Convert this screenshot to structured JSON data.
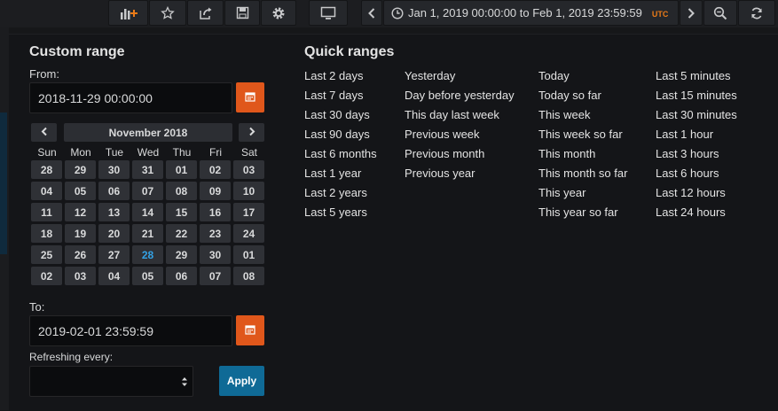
{
  "toolbar": {
    "time_range": "Jan 1, 2019 00:00:00 to Feb 1, 2019 23:59:59",
    "timezone": "UTC",
    "buttons": [
      "add-panel-icon",
      "star-icon",
      "share-icon",
      "save-icon",
      "settings-icon",
      "tv-mode-icon",
      "chevron-left-icon",
      "clock-icon",
      "chevron-right-icon",
      "zoom-out-icon",
      "refresh-icon"
    ]
  },
  "custom_range": {
    "title": "Custom range",
    "from_label": "From:",
    "from_value": "2018-11-29 00:00:00",
    "to_label": "To:",
    "to_value": "2019-02-01 23:59:59",
    "refresh_label": "Refreshing every:",
    "refresh_value": "",
    "apply_label": "Apply"
  },
  "calendar": {
    "month": "November 2018",
    "weekdays": [
      "Sun",
      "Mon",
      "Tue",
      "Wed",
      "Thu",
      "Fri",
      "Sat"
    ],
    "weeks": [
      [
        "28",
        "29",
        "30",
        "31",
        "01",
        "02",
        "03"
      ],
      [
        "04",
        "05",
        "06",
        "07",
        "08",
        "09",
        "10"
      ],
      [
        "11",
        "12",
        "13",
        "14",
        "15",
        "16",
        "17"
      ],
      [
        "18",
        "19",
        "20",
        "21",
        "22",
        "23",
        "24"
      ],
      [
        "25",
        "26",
        "27",
        "28",
        "29",
        "30",
        "01"
      ],
      [
        "02",
        "03",
        "04",
        "05",
        "06",
        "07",
        "08"
      ]
    ],
    "highlighted_day": "28",
    "prev": "<",
    "next": ">"
  },
  "quick_ranges": {
    "title": "Quick ranges",
    "columns": [
      [
        "Last 2 days",
        "Last 7 days",
        "Last 30 days",
        "Last 90 days",
        "Last 6 months",
        "Last 1 year",
        "Last 2 years",
        "Last 5 years"
      ],
      [
        "Yesterday",
        "Day before yesterday",
        "This day last week",
        "Previous week",
        "Previous month",
        "Previous year"
      ],
      [
        "Today",
        "Today so far",
        "This week",
        "This week so far",
        "This month",
        "This month so far",
        "This year",
        "This year so far"
      ],
      [
        "Last 5 minutes",
        "Last 15 minutes",
        "Last 30 minutes",
        "Last 1 hour",
        "Last 3 hours",
        "Last 6 hours",
        "Last 12 hours",
        "Last 24 hours"
      ]
    ]
  },
  "colors": {
    "accent_orange": "#e0571b",
    "apply_blue": "#0f6a96",
    "today_blue": "#33a2e5",
    "utc_orange": "#eb7b18"
  }
}
